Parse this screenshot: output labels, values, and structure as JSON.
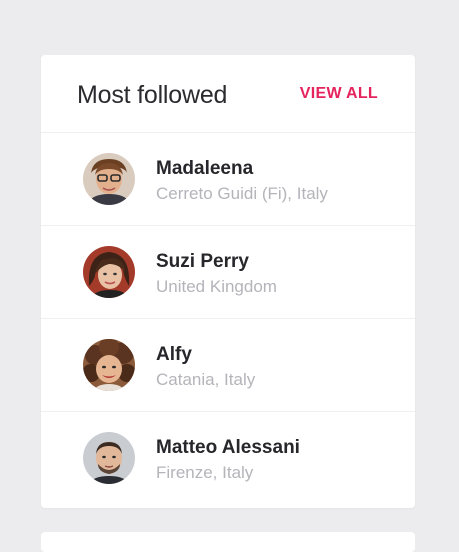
{
  "widget": {
    "title": "Most followed",
    "view_all_label": "VIEW ALL",
    "accent_color": "#e5245e"
  },
  "people": [
    {
      "name": "Madaleena",
      "location": "Cerreto Guidi (Fi), Italy",
      "avatar": "avatar-woman-short-hair-glasses"
    },
    {
      "name": "Suzi Perry",
      "location": "United Kingdom",
      "avatar": "avatar-woman-dark-bob"
    },
    {
      "name": "Alfy",
      "location": "Catania, Italy",
      "avatar": "avatar-woman-curly-hair"
    },
    {
      "name": "Matteo Alessani",
      "location": "Firenze, Italy",
      "avatar": "avatar-man-bald"
    }
  ]
}
